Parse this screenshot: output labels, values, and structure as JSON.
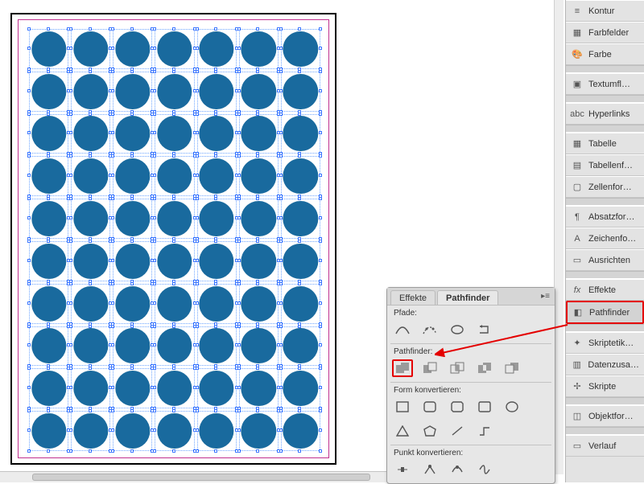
{
  "panels": {
    "kontur": "Kontur",
    "farbfelder": "Farbfelder",
    "farbe": "Farbe",
    "textumfl": "Textumfl…",
    "hyperlinks": "Hyperlinks",
    "tabelle": "Tabelle",
    "tabellenf": "Tabellenf…",
    "zellenfor": "Zellenfor…",
    "absatzfor": "Absatzfor…",
    "zeichenfo": "Zeichenfo…",
    "ausrichten": "Ausrichten",
    "effekte": "Effekte",
    "pathfinder": "Pathfinder",
    "skriptetik": "Skriptetik…",
    "datenzusa": "Datenzusa…",
    "skripte": "Skripte",
    "objektfor": "Objektfor…",
    "verlauf": "Verlauf"
  },
  "floatPanel": {
    "tabs": {
      "effekte": "Effekte",
      "pathfinder": "Pathfinder"
    },
    "sections": {
      "pfade": "Pfade:",
      "pathfinder": "Pathfinder:",
      "formKonvertieren": "Form konvertieren:",
      "punktKonvertieren": "Punkt konvertieren:"
    }
  },
  "grid": {
    "cols": 7,
    "rows": 10
  },
  "colors": {
    "shape": "#196a9e",
    "highlight": "#e40000"
  }
}
